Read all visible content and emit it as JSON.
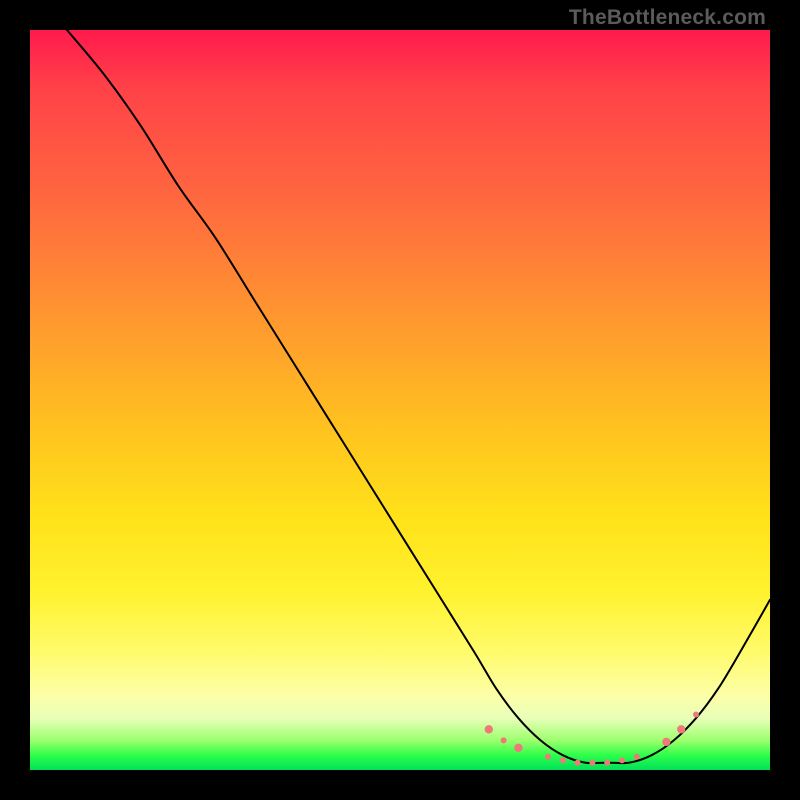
{
  "watermark": "TheBottleneck.com",
  "chart_data": {
    "type": "line",
    "title": "",
    "xlabel": "",
    "ylabel": "",
    "xlim": [
      0,
      100
    ],
    "ylim": [
      0,
      100
    ],
    "grid": false,
    "legend": false,
    "series": [
      {
        "name": "bottleneck-curve",
        "color": "#000000",
        "x": [
          5,
          10,
          15,
          20,
          25,
          30,
          35,
          40,
          45,
          50,
          55,
          60,
          63,
          66,
          69,
          72,
          75,
          78,
          81,
          84,
          87,
          90,
          93,
          96,
          100
        ],
        "y": [
          100,
          94,
          87,
          79,
          72,
          64,
          56,
          48,
          40,
          32,
          24,
          16,
          11,
          7,
          4,
          2,
          1,
          1,
          1,
          2,
          4,
          7,
          11,
          16,
          23
        ]
      }
    ],
    "highlight_points": {
      "color": "#f07878",
      "radius_small": 3.0,
      "radius_large": 4.2,
      "points": [
        {
          "x": 62,
          "y": 5.5,
          "r": "large"
        },
        {
          "x": 64,
          "y": 4.0,
          "r": "small"
        },
        {
          "x": 66,
          "y": 3.0,
          "r": "large"
        },
        {
          "x": 70,
          "y": 1.8,
          "r": "small"
        },
        {
          "x": 72,
          "y": 1.3,
          "r": "small"
        },
        {
          "x": 74,
          "y": 1.0,
          "r": "small"
        },
        {
          "x": 76,
          "y": 1.0,
          "r": "small"
        },
        {
          "x": 78,
          "y": 1.0,
          "r": "small"
        },
        {
          "x": 80,
          "y": 1.3,
          "r": "small"
        },
        {
          "x": 82,
          "y": 1.8,
          "r": "small"
        },
        {
          "x": 86,
          "y": 3.8,
          "r": "large"
        },
        {
          "x": 88,
          "y": 5.5,
          "r": "large"
        },
        {
          "x": 90,
          "y": 7.5,
          "r": "small"
        }
      ]
    }
  }
}
